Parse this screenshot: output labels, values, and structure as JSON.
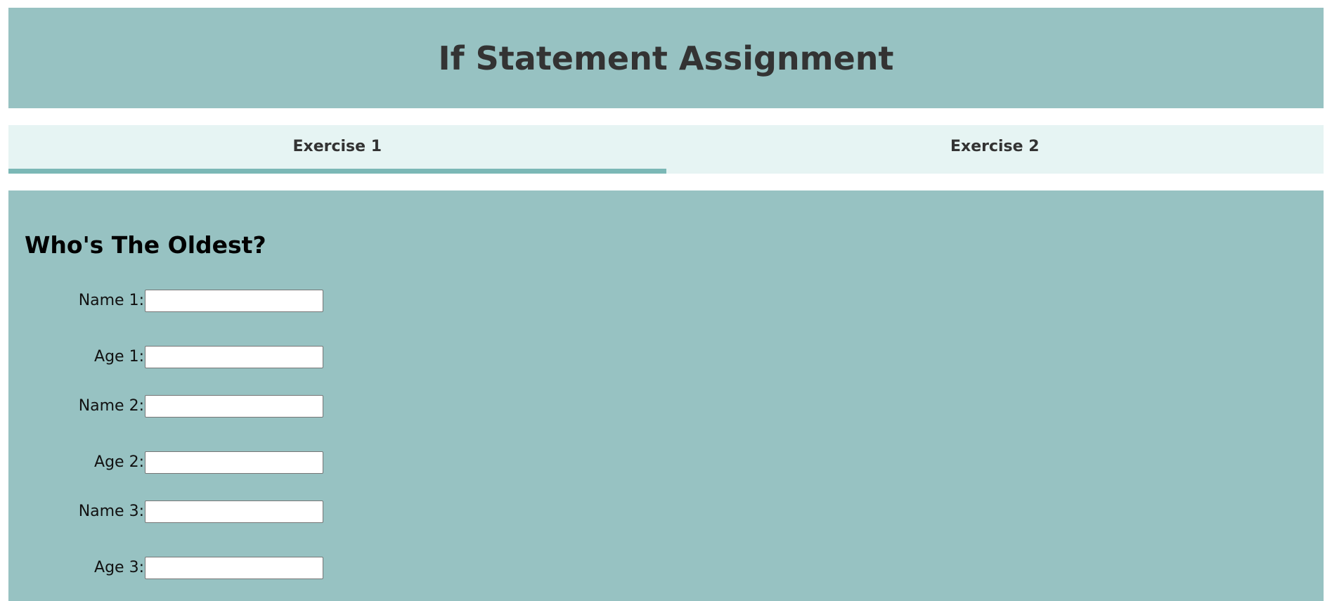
{
  "header": {
    "title": "If Statement Assignment"
  },
  "tabs": [
    {
      "label": "Exercise 1",
      "active": true
    },
    {
      "label": "Exercise 2",
      "active": false
    }
  ],
  "exercise": {
    "heading": "Who's The Oldest?",
    "fields": [
      {
        "label": "Name 1:",
        "value": "",
        "placeholder": ""
      },
      {
        "label": "Age 1:",
        "value": "",
        "placeholder": ""
      },
      {
        "label": "Name 2:",
        "value": "",
        "placeholder": ""
      },
      {
        "label": "Age 2:",
        "value": "",
        "placeholder": ""
      },
      {
        "label": "Name 3:",
        "value": "",
        "placeholder": ""
      },
      {
        "label": "Age 3:",
        "value": "",
        "placeholder": ""
      }
    ]
  },
  "colors": {
    "panel": "#97c2c2",
    "tab_bar": "#e6f4f3",
    "active_tab_indicator": "#7bb8b6",
    "title_text": "#333333"
  }
}
